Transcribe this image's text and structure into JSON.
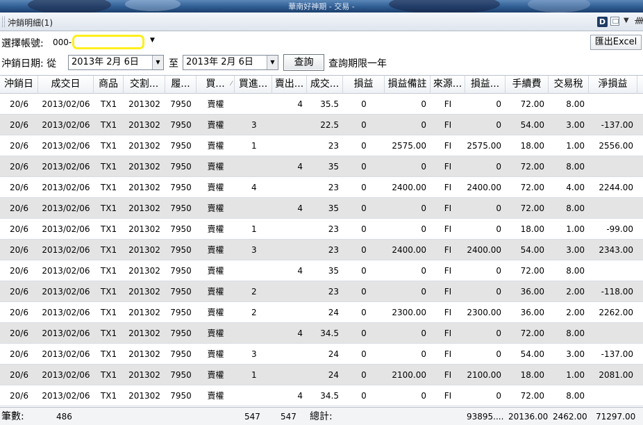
{
  "app": {
    "title": "華南好神期 - 交易 -"
  },
  "panel": {
    "tab_title": "沖銷明細(1)",
    "d_icon_label": "D"
  },
  "filters": {
    "account_label": "選擇帳號:",
    "account_prefix": "000-",
    "date_label": "沖銷日期: 從",
    "date_from": "2013年  2月  6日",
    "to_label": "至",
    "date_to": "2013年  2月  6日",
    "query_button": "查詢",
    "query_note": "查詢期限一年",
    "export_button": "匯出Excel"
  },
  "table": {
    "columns": [
      "沖銷日",
      "成交日",
      "商品",
      "交割...",
      "履...",
      "買...",
      "買進...",
      "賣出...",
      "成交...",
      "損益",
      "損益備註",
      "來源...",
      "損益...",
      "手續費",
      "交易稅",
      "淨損益"
    ],
    "rows": [
      [
        "20/6",
        "2013/02/06",
        "TX1",
        "201302",
        "7950",
        "賣權",
        "",
        "4",
        "35.5",
        "0",
        "0",
        "FI",
        "0",
        "72.00",
        "8.00",
        ""
      ],
      [
        "20/6",
        "2013/02/06",
        "TX1",
        "201302",
        "7950",
        "賣權",
        "3",
        "",
        "22.5",
        "0",
        "0",
        "FI",
        "0",
        "54.00",
        "3.00",
        "-137.00"
      ],
      [
        "20/6",
        "2013/02/06",
        "TX1",
        "201302",
        "7950",
        "賣權",
        "1",
        "",
        "23",
        "0",
        "2575.00",
        "FI",
        "2575.00",
        "18.00",
        "1.00",
        "2556.00"
      ],
      [
        "20/6",
        "2013/02/06",
        "TX1",
        "201302",
        "7950",
        "賣權",
        "",
        "4",
        "35",
        "0",
        "0",
        "FI",
        "0",
        "72.00",
        "8.00",
        ""
      ],
      [
        "20/6",
        "2013/02/06",
        "TX1",
        "201302",
        "7950",
        "賣權",
        "4",
        "",
        "23",
        "0",
        "2400.00",
        "FI",
        "2400.00",
        "72.00",
        "4.00",
        "2244.00"
      ],
      [
        "20/6",
        "2013/02/06",
        "TX1",
        "201302",
        "7950",
        "賣權",
        "",
        "4",
        "35",
        "0",
        "0",
        "FI",
        "0",
        "72.00",
        "8.00",
        ""
      ],
      [
        "20/6",
        "2013/02/06",
        "TX1",
        "201302",
        "7950",
        "賣權",
        "1",
        "",
        "23",
        "0",
        "0",
        "FI",
        "0",
        "18.00",
        "1.00",
        "-99.00"
      ],
      [
        "20/6",
        "2013/02/06",
        "TX1",
        "201302",
        "7950",
        "賣權",
        "3",
        "",
        "23",
        "0",
        "2400.00",
        "FI",
        "2400.00",
        "54.00",
        "3.00",
        "2343.00"
      ],
      [
        "20/6",
        "2013/02/06",
        "TX1",
        "201302",
        "7950",
        "賣權",
        "",
        "4",
        "35",
        "0",
        "0",
        "FI",
        "0",
        "72.00",
        "8.00",
        ""
      ],
      [
        "20/6",
        "2013/02/06",
        "TX1",
        "201302",
        "7950",
        "賣權",
        "2",
        "",
        "23",
        "0",
        "0",
        "FI",
        "0",
        "36.00",
        "2.00",
        "-118.00"
      ],
      [
        "20/6",
        "2013/02/06",
        "TX1",
        "201302",
        "7950",
        "賣權",
        "2",
        "",
        "24",
        "0",
        "2300.00",
        "FI",
        "2300.00",
        "36.00",
        "2.00",
        "2262.00"
      ],
      [
        "20/6",
        "2013/02/06",
        "TX1",
        "201302",
        "7950",
        "賣權",
        "",
        "4",
        "34.5",
        "0",
        "0",
        "FI",
        "0",
        "72.00",
        "8.00",
        ""
      ],
      [
        "20/6",
        "2013/02/06",
        "TX1",
        "201302",
        "7950",
        "賣權",
        "3",
        "",
        "24",
        "0",
        "0",
        "FI",
        "0",
        "54.00",
        "3.00",
        "-137.00"
      ],
      [
        "20/6",
        "2013/02/06",
        "TX1",
        "201302",
        "7950",
        "賣權",
        "1",
        "",
        "24",
        "0",
        "2100.00",
        "FI",
        "2100.00",
        "18.00",
        "1.00",
        "2081.00"
      ],
      [
        "20/6",
        "2013/02/06",
        "TX1",
        "201302",
        "7950",
        "賣權",
        "",
        "4",
        "34.5",
        "0",
        "0",
        "FI",
        "0",
        "72.00",
        "8.00",
        ""
      ]
    ]
  },
  "footer": {
    "count_label": "筆數:",
    "count_value": "486",
    "buy_total": "547",
    "sell_total": "547",
    "total_label": "總計:",
    "pnl_total": "93895....",
    "fee_total": "20136.00",
    "tax_total": "2462.00",
    "net_total": "71297.00"
  }
}
